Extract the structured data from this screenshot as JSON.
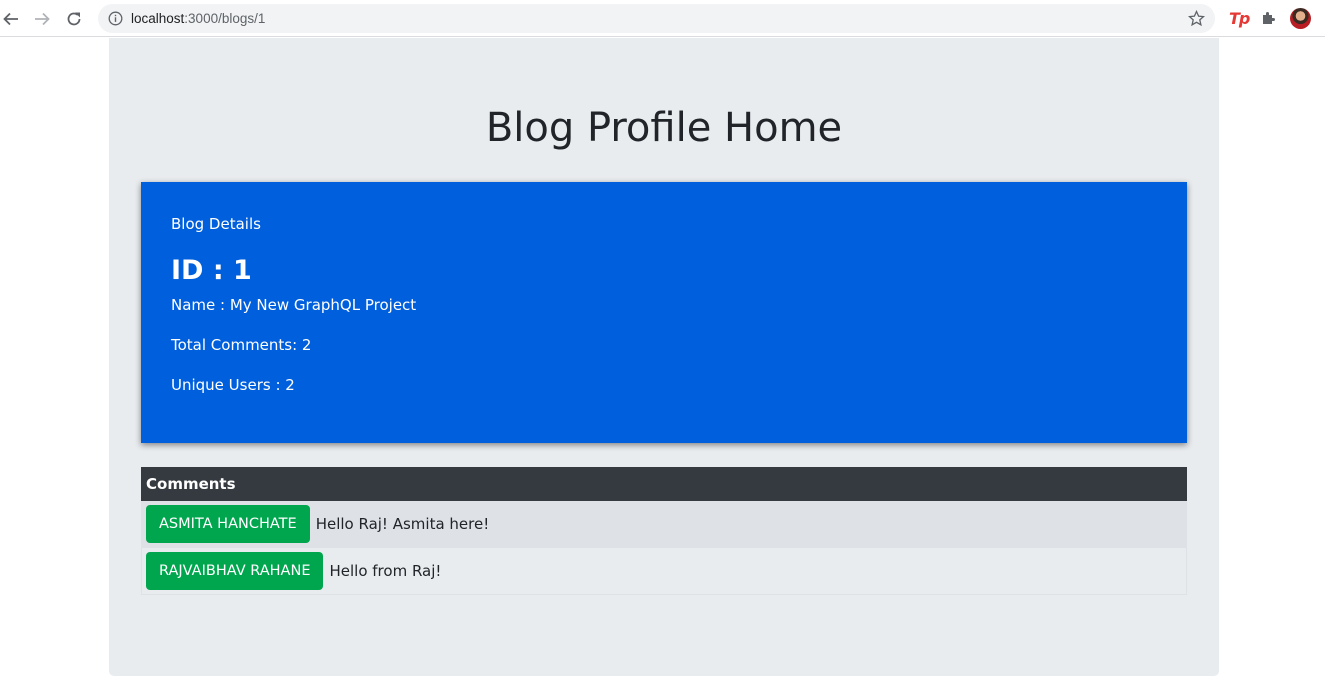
{
  "browser": {
    "url_host": "localhost",
    "url_rest": ":3000/blogs/1",
    "extension_label": "Tp"
  },
  "page": {
    "title": "Blog Profile Home"
  },
  "blog_card": {
    "heading": "Blog Details",
    "id_text": "ID : 1",
    "name_text": "Name : My New GraphQL Project",
    "total_comments_text": "Total Comments: 2",
    "unique_users_text": "Unique Users : 2",
    "background_color": "#005fdc"
  },
  "comments": {
    "header": "Comments",
    "rows": [
      {
        "user": "ASMITA HANCHATE",
        "text": "Hello Raj! Asmita here!"
      },
      {
        "user": "RAJVAIBHAV RAHANE",
        "text": "Hello from Raj!"
      }
    ],
    "user_button_color": "#00a64e"
  }
}
